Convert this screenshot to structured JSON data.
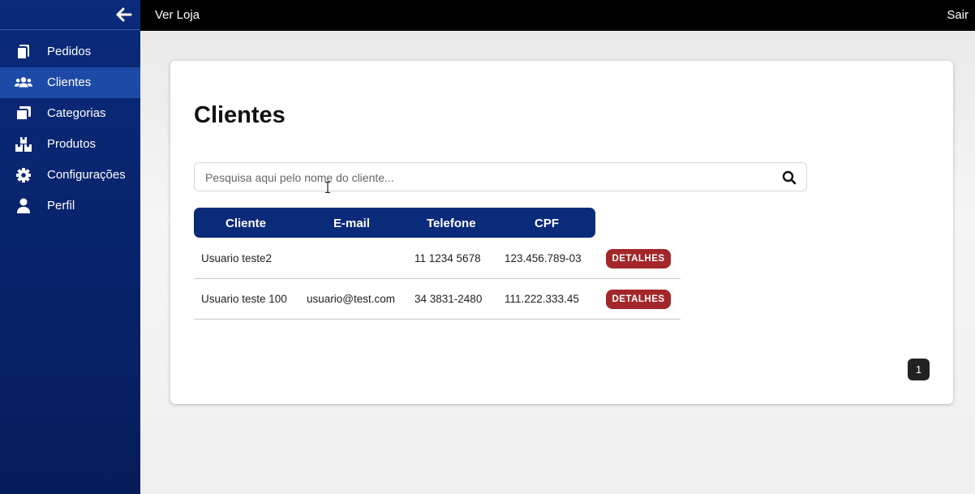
{
  "topbar": {
    "store_link": "Ver Loja",
    "logout": "Sair"
  },
  "sidebar": {
    "items": [
      {
        "label": "Pedidos",
        "icon": "copy-icon"
      },
      {
        "label": "Clientes",
        "icon": "users-icon",
        "active": true
      },
      {
        "label": "Categorias",
        "icon": "clone-icon"
      },
      {
        "label": "Produtos",
        "icon": "boxes-icon"
      },
      {
        "label": "Configurações",
        "icon": "gear-icon"
      },
      {
        "label": "Perfil",
        "icon": "user-icon"
      }
    ]
  },
  "main": {
    "title": "Clientes",
    "search": {
      "placeholder": "Pesquisa aqui pelo nome do cliente...",
      "value": ""
    },
    "table": {
      "headers": [
        "Cliente",
        "E-mail",
        "Telefone",
        "CPF"
      ],
      "rows": [
        {
          "cliente": "Usuario teste2",
          "email": "",
          "telefone": "11 1234 5678",
          "cpf": "123.456.789-03",
          "action": "DETALHES"
        },
        {
          "cliente": "Usuario teste 100",
          "email": "usuario@test.com",
          "telefone": "34 3831-2480",
          "cpf": "111.222.333.45",
          "action": "DETALHES"
        }
      ]
    },
    "pagination": {
      "current": "1"
    }
  },
  "colors": {
    "sidebar": "#0a2a7a",
    "active_item": "#1d4aa7",
    "details_button": "#a3272a"
  }
}
